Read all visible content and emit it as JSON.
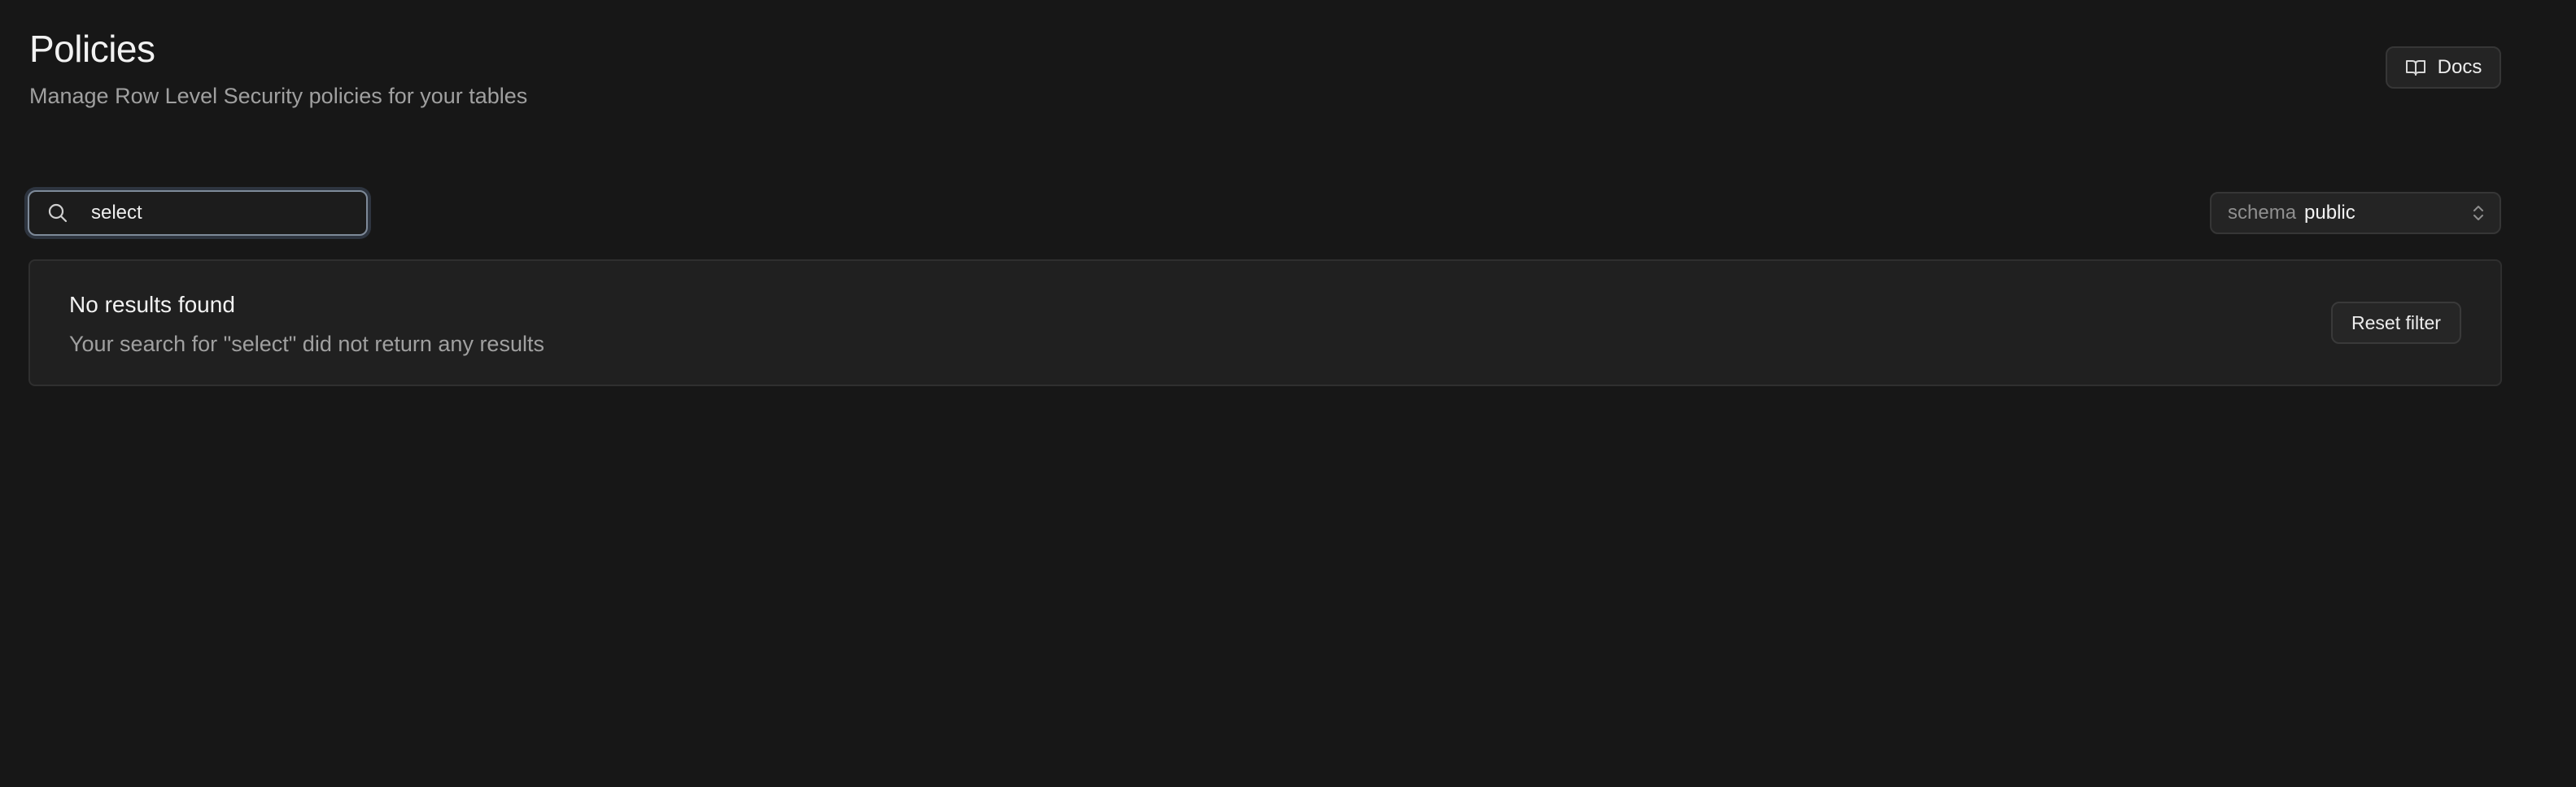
{
  "header": {
    "title": "Policies",
    "subtitle": "Manage Row Level Security policies for your tables"
  },
  "toolbar": {
    "docs_label": "Docs",
    "docs_icon": "book-open-icon"
  },
  "search": {
    "value": "select",
    "icon": "search-icon"
  },
  "schema_selector": {
    "label": "schema",
    "value": "public",
    "icon": "chevron-up-down-icon"
  },
  "empty_state": {
    "title": "No results found",
    "description": "Your search for \"select\" did not return any results",
    "reset_label": "Reset filter"
  },
  "colors": {
    "background": "#171717",
    "panel": "#202020",
    "text_primary": "#ededed",
    "text_secondary": "#a0a0a0",
    "focus_ring": "#7e8a99"
  }
}
